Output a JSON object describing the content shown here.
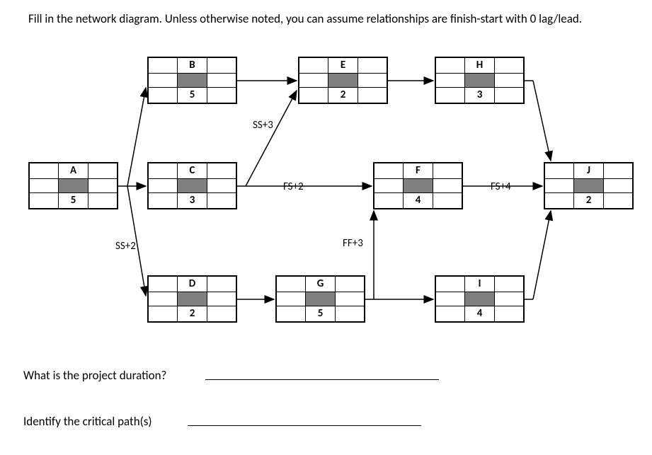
{
  "instruction": "Fill in the network diagram.    Unless otherwise noted, you can assume relationships are finish-start with 0 lag/lead.",
  "nodes": {
    "A": {
      "name": "A",
      "dur": "5"
    },
    "B": {
      "name": "B",
      "dur": "5"
    },
    "C": {
      "name": "C",
      "dur": "3"
    },
    "D": {
      "name": "D",
      "dur": "2"
    },
    "E": {
      "name": "E",
      "dur": "2"
    },
    "F": {
      "name": "F",
      "dur": "4"
    },
    "G": {
      "name": "G",
      "dur": "5"
    },
    "H": {
      "name": "H",
      "dur": "3"
    },
    "I": {
      "name": "I",
      "dur": "4"
    },
    "J": {
      "name": "J",
      "dur": "2"
    }
  },
  "edge_labels": {
    "ss3": "SS+3",
    "fs2": "FS+2",
    "ss2": "SS+2",
    "ff3": "FF+3",
    "fs4": "FS+4"
  },
  "questions": {
    "duration": "What is the project duration?",
    "critical": "Identify the critical path(s)"
  }
}
